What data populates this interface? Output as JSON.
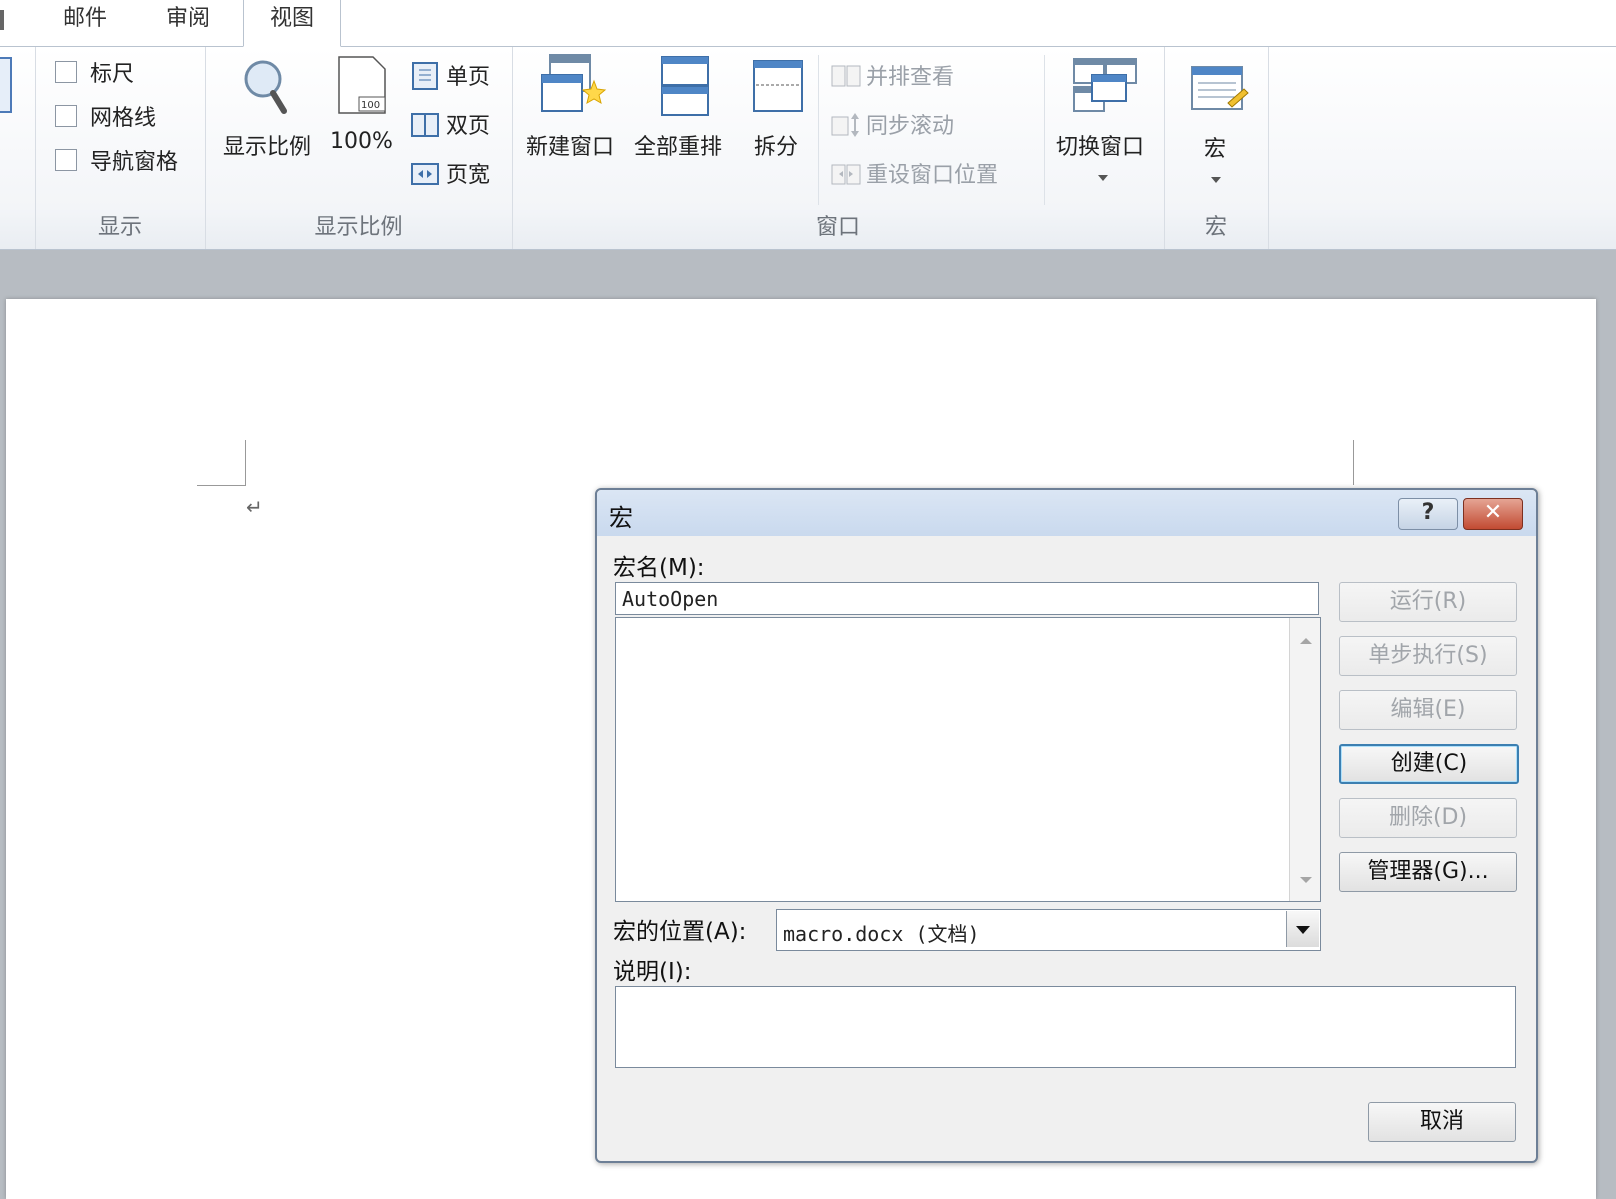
{
  "tabs": [
    {
      "label": "邮件"
    },
    {
      "label": "审阅"
    },
    {
      "label": "视图"
    }
  ],
  "ribbon": {
    "show_group": {
      "label": "显示",
      "ruler": "标尺",
      "gridlines": "网格线",
      "nav_pane": "导航窗格"
    },
    "zoom_group": {
      "label": "显示比例",
      "zoom": "显示比例",
      "zoom100": "100%",
      "one_page": "单页",
      "two_pages": "双页",
      "page_width": "页宽",
      "icon_badge": "100"
    },
    "window_group": {
      "label": "窗口",
      "new_window": "新建窗口",
      "arrange_all": "全部重排",
      "split": "拆分",
      "side_by_side": "并排查看",
      "sync_scroll": "同步滚动",
      "reset_position": "重设窗口位置",
      "switch_windows": "切换窗口"
    },
    "macro_group": {
      "label": "宏",
      "macros": "宏"
    }
  },
  "document": {
    "paragraph_mark": "↵"
  },
  "dialog": {
    "title": "宏",
    "help_glyph": "?",
    "close_glyph": "✕",
    "macro_name_label": "宏名(M):",
    "macro_name_value": "AutoOpen",
    "macros_in_label": "宏的位置(A):",
    "macros_in_value": "macro.docx (文档)",
    "description_label": "说明(I):",
    "description_value": "",
    "buttons": {
      "run": "运行(R)",
      "step_into": "单步执行(S)",
      "edit": "编辑(E)",
      "create": "创建(C)",
      "delete": "删除(D)",
      "organizer": "管理器(G)...",
      "cancel": "取消"
    }
  }
}
